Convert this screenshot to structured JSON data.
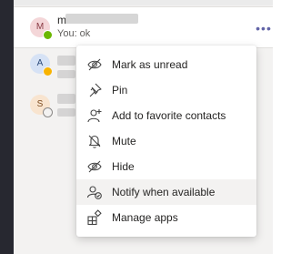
{
  "chat_list": {
    "rows": [
      {
        "initial": "M",
        "name_visible": "m",
        "preview": "You: ok",
        "presence": "available"
      },
      {
        "initial": "A",
        "presence": "away"
      },
      {
        "initial": "S",
        "presence": "offline"
      }
    ],
    "more_options": "•••"
  },
  "context_menu": {
    "items": [
      {
        "label": "Mark as unread",
        "icon": "eye-off-icon"
      },
      {
        "label": "Pin",
        "icon": "pin-icon"
      },
      {
        "label": "Add to favorite contacts",
        "icon": "add-contact-icon"
      },
      {
        "label": "Mute",
        "icon": "mute-icon"
      },
      {
        "label": "Hide",
        "icon": "hide-icon"
      },
      {
        "label": "Notify when available",
        "icon": "notify-icon",
        "highlighted": true
      },
      {
        "label": "Manage apps",
        "icon": "apps-icon"
      }
    ]
  },
  "colors": {
    "accent": "#6264a7",
    "available": "#6bb700",
    "away": "#f8b300"
  }
}
